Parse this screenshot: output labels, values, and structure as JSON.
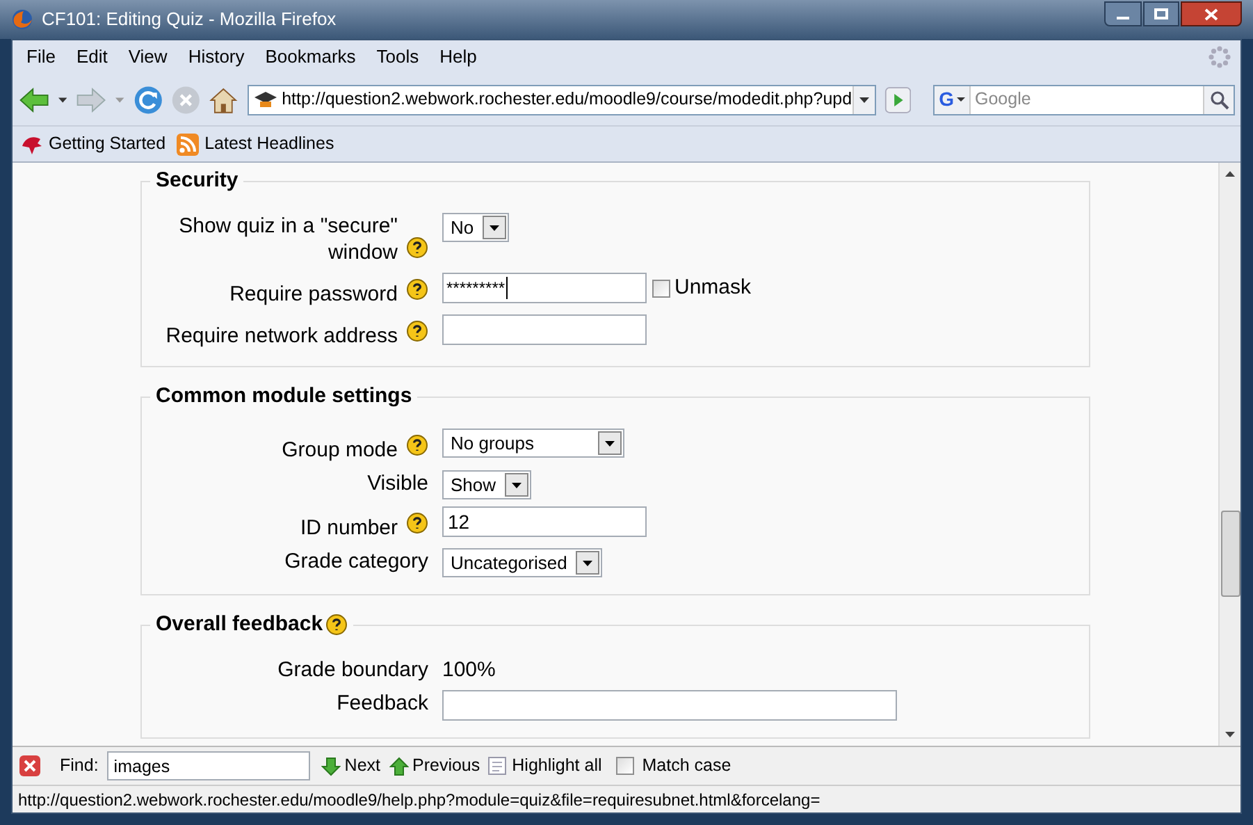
{
  "window": {
    "title": "CF101: Editing Quiz - Mozilla Firefox"
  },
  "menu": [
    "File",
    "Edit",
    "View",
    "History",
    "Bookmarks",
    "Tools",
    "Help"
  ],
  "address": {
    "value": "http://question2.webwork.rochester.edu/moodle9/course/modedit.php?upd"
  },
  "search": {
    "engine": "G",
    "placeholder": "Google"
  },
  "bookmarks": [
    {
      "label": "Getting Started",
      "kind": "page"
    },
    {
      "label": "Latest Headlines",
      "kind": "feed"
    }
  ],
  "sections": [
    {
      "title": "Security",
      "help": false,
      "fields": [
        {
          "label": "Show quiz in a \"secure\" window",
          "help": true,
          "kind": "select",
          "value": "No"
        },
        {
          "label": "Require password",
          "help": true,
          "kind": "password",
          "value": "*********",
          "unmask": {
            "label": "Unmask",
            "checked": false
          }
        },
        {
          "label": "Require network address",
          "help": true,
          "kind": "text"
        }
      ]
    },
    {
      "title": "Common module settings",
      "help": false,
      "fields": [
        {
          "label": "Group mode",
          "help": true,
          "kind": "select",
          "value": "No groups"
        },
        {
          "label": "Visible",
          "help": false,
          "kind": "select",
          "value": "Show"
        },
        {
          "label": "ID number",
          "help": true,
          "kind": "text",
          "value": "12"
        },
        {
          "label": "Grade category",
          "help": false,
          "kind": "select",
          "value": "Uncategorised"
        }
      ]
    },
    {
      "title": "Overall feedback",
      "help": true,
      "fields": [
        {
          "label": "Grade boundary",
          "help": false,
          "kind": "static",
          "value": "100%"
        },
        {
          "label": "Feedback",
          "help": false,
          "kind": "longtext"
        }
      ]
    }
  ],
  "find_bar": {
    "label": "Find:",
    "value": "images",
    "next": "Next",
    "previous": "Previous",
    "highlight": "Highlight all",
    "match_case": {
      "label": "Match case",
      "checked": false
    }
  },
  "status_bar": "http://question2.webwork.rochester.edu/moodle9/help.php?module=quiz&file=requiresubnet.html&forcelang="
}
